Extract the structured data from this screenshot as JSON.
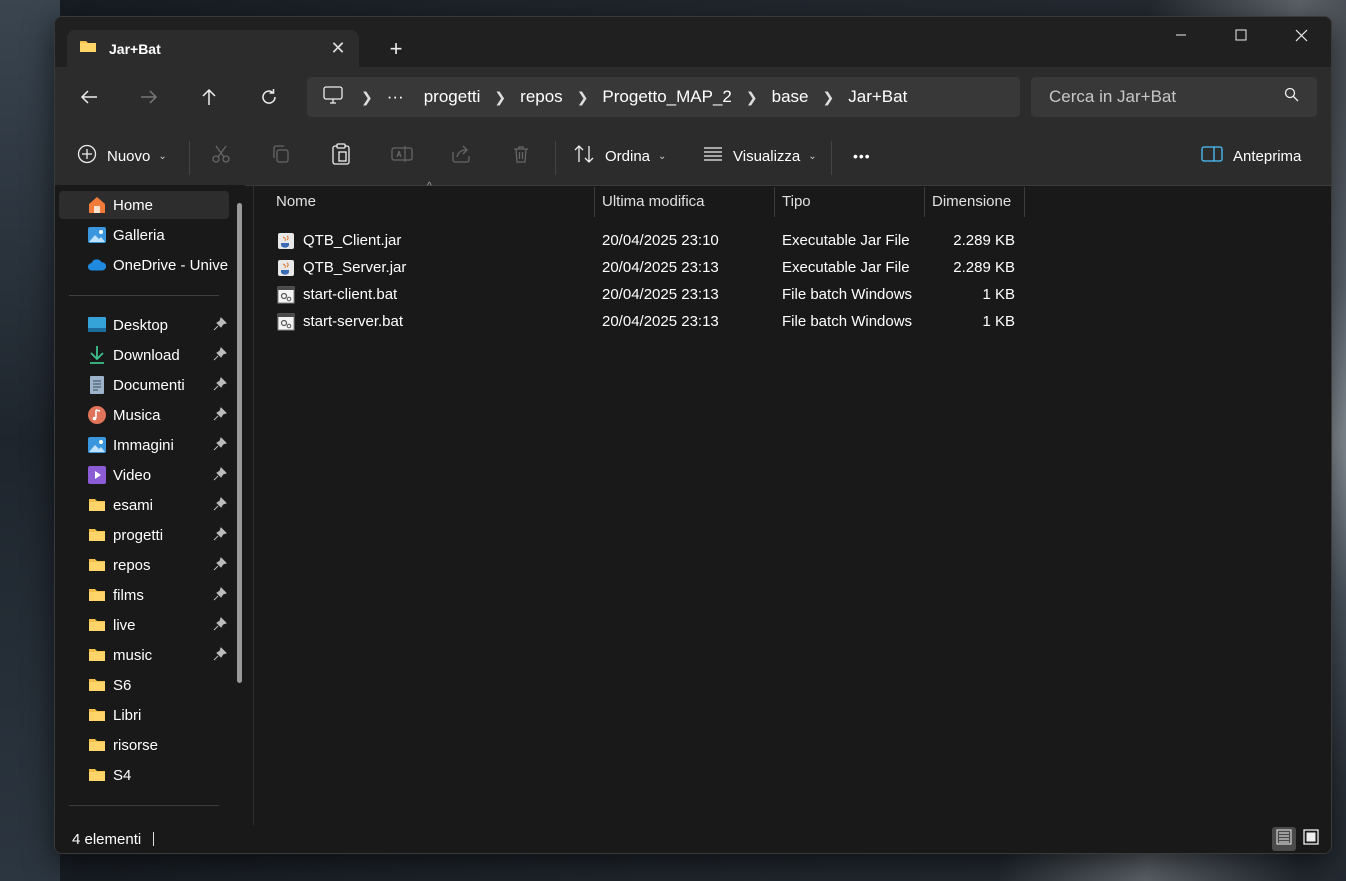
{
  "window": {
    "tab_title": "Jar+Bat",
    "close_tab_glyph": "✕",
    "new_tab_glyph": "+"
  },
  "breadcrumb": {
    "overflow": "···",
    "items": [
      "progetti",
      "repos",
      "Progetto_MAP_2",
      "base",
      "Jar+Bat"
    ]
  },
  "search": {
    "placeholder": "Cerca in Jar+Bat"
  },
  "commands": {
    "new": "Nuovo",
    "sort": "Ordina",
    "view": "Visualizza",
    "more": "•••",
    "preview": "Anteprima"
  },
  "sidebar": {
    "top": [
      {
        "label": "Home",
        "icon": "home-icon"
      },
      {
        "label": "Galleria",
        "icon": "gallery-icon"
      },
      {
        "label": "OneDrive - Univer",
        "icon": "onedrive-icon"
      }
    ],
    "pinned": [
      {
        "label": "Desktop",
        "icon": "desktop-icon"
      },
      {
        "label": "Download",
        "icon": "download-icon"
      },
      {
        "label": "Documenti",
        "icon": "documents-icon"
      },
      {
        "label": "Musica",
        "icon": "music-icon"
      },
      {
        "label": "Immagini",
        "icon": "pictures-icon"
      },
      {
        "label": "Video",
        "icon": "video-icon"
      },
      {
        "label": "esami",
        "icon": "folder-icon"
      },
      {
        "label": "progetti",
        "icon": "folder-icon"
      },
      {
        "label": "repos",
        "icon": "folder-icon"
      },
      {
        "label": "films",
        "icon": "folder-icon"
      },
      {
        "label": "live",
        "icon": "folder-icon"
      },
      {
        "label": "music",
        "icon": "folder-icon"
      }
    ],
    "folders": [
      {
        "label": "S6",
        "icon": "folder-icon"
      },
      {
        "label": "Libri",
        "icon": "folder-icon"
      },
      {
        "label": "risorse",
        "icon": "folder-icon"
      },
      {
        "label": "S4",
        "icon": "folder-icon"
      }
    ]
  },
  "columns": {
    "name": "Nome",
    "modified": "Ultima modifica",
    "type": "Tipo",
    "size": "Dimensione"
  },
  "files": [
    {
      "name": "QTB_Client.jar",
      "modified": "20/04/2025 23:10",
      "type": "Executable Jar File",
      "size": "2.289 KB",
      "icon": "jar-file-icon"
    },
    {
      "name": "QTB_Server.jar",
      "modified": "20/04/2025 23:13",
      "type": "Executable Jar File",
      "size": "2.289 KB",
      "icon": "jar-file-icon"
    },
    {
      "name": "start-client.bat",
      "modified": "20/04/2025 23:13",
      "type": "File batch Windows",
      "size": "1 KB",
      "icon": "bat-file-icon"
    },
    {
      "name": "start-server.bat",
      "modified": "20/04/2025 23:13",
      "type": "File batch Windows",
      "size": "1 KB",
      "icon": "bat-file-icon"
    }
  ],
  "status": {
    "count": "4 elementi"
  },
  "colors": {
    "folder": "#f2c04b",
    "accent": "#4cc2ff",
    "window_bg": "#191919",
    "toolbar_bg": "#2c2c2c"
  }
}
